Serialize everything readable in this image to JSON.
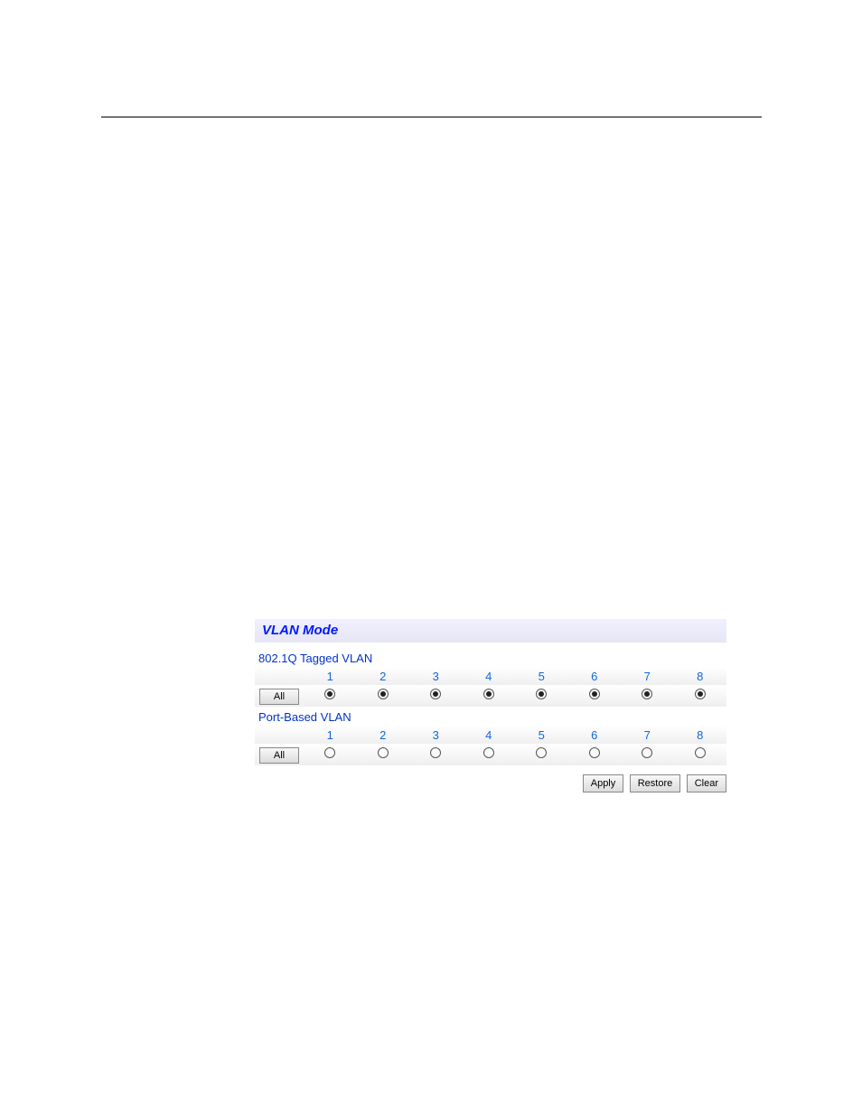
{
  "hr": {},
  "panel": {
    "title": "VLAN Mode",
    "tagged": {
      "label": "802.1Q Tagged VLAN",
      "ports": [
        "1",
        "2",
        "3",
        "4",
        "5",
        "6",
        "7",
        "8"
      ],
      "all_label": "All",
      "selected": [
        true,
        true,
        true,
        true,
        true,
        true,
        true,
        true
      ]
    },
    "portbased": {
      "label": "Port-Based VLAN",
      "ports": [
        "1",
        "2",
        "3",
        "4",
        "5",
        "6",
        "7",
        "8"
      ],
      "all_label": "All",
      "selected": [
        false,
        false,
        false,
        false,
        false,
        false,
        false,
        false
      ]
    },
    "buttons": {
      "apply": "Apply",
      "restore": "Restore",
      "clear": "Clear"
    }
  }
}
